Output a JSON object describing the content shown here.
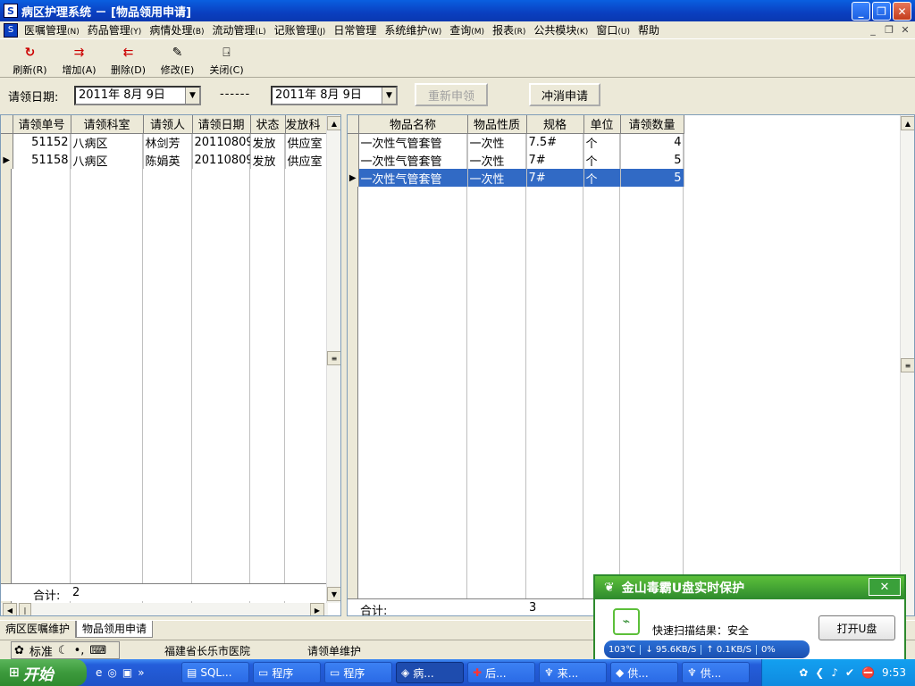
{
  "window": {
    "title": "病区护理系统 － [物品领用申请]"
  },
  "menu": [
    {
      "label": "医嘱管理",
      "hotkey": "(N)"
    },
    {
      "label": "药品管理",
      "hotkey": "(Y)"
    },
    {
      "label": "病情处理",
      "hotkey": "(B)"
    },
    {
      "label": "流动管理",
      "hotkey": "(L)"
    },
    {
      "label": "记账管理",
      "hotkey": "(J)"
    },
    {
      "label": "日常管理",
      "hotkey": ""
    },
    {
      "label": "系统维护",
      "hotkey": "(W)"
    },
    {
      "label": "查询",
      "hotkey": "(M)"
    },
    {
      "label": "报表",
      "hotkey": "(R)"
    },
    {
      "label": "公共模块",
      "hotkey": "(K)"
    },
    {
      "label": "窗口",
      "hotkey": "(U)"
    },
    {
      "label": "帮助",
      "hotkey": ""
    }
  ],
  "toolbar": {
    "refresh": "刷新(R)",
    "add": "增加(A)",
    "delete": "删除(D)",
    "edit": "修改(E)",
    "close": "关闭(C)"
  },
  "filter": {
    "label": "请领日期:",
    "date_from": "2011年 8月 9日",
    "separator": "------",
    "date_to": "2011年 8月 9日",
    "reapply_button": "重新申领",
    "cancel_button": "冲消申请"
  },
  "left_grid": {
    "columns": [
      "请领单号",
      "请领科室",
      "请领人",
      "请领日期",
      "状态",
      "发放科"
    ],
    "rows": [
      {
        "id": "51152",
        "dept": "八病区",
        "person": "林剑芳",
        "date": "20110809",
        "status": "发放",
        "supply": "供应室"
      },
      {
        "id": "51158",
        "dept": "八病区",
        "person": "陈娟英",
        "date": "20110809",
        "status": "发放",
        "supply": "供应室"
      }
    ],
    "summary_label": "合计:",
    "summary_value": "2"
  },
  "right_grid": {
    "columns": [
      "物品名称",
      "物品性质",
      "规格",
      "单位",
      "请领数量"
    ],
    "rows": [
      {
        "name": "一次性气管套管",
        "nature": "一次性",
        "spec": "7.5#",
        "unit": "个",
        "qty": "4"
      },
      {
        "name": "一次性气管套管",
        "nature": "一次性",
        "spec": "7#",
        "unit": "个",
        "qty": "5"
      },
      {
        "name": "一次性气管套管",
        "nature": "一次性",
        "spec": "7#",
        "unit": "个",
        "qty": "5"
      }
    ],
    "summary_label": "合计:",
    "summary_value": "3"
  },
  "tabs": [
    "病区医嘱维护",
    "物品领用申请"
  ],
  "status": {
    "ime_mode": "标准",
    "hospital": "福建省长乐市医院",
    "module": "请领单维护"
  },
  "popup": {
    "title": "金山毒霸U盘实时保护",
    "scan_result": "快速扫描结果：安全",
    "open_button": "打开U盘",
    "temp": "103℃",
    "down": "95.6KB/S",
    "up": "0.1KB/S",
    "load": "0%"
  },
  "taskbar": {
    "start": "开始",
    "tasks": [
      "SQL...",
      "程序",
      "程序",
      "病...",
      "后...",
      "来...",
      "供...",
      "供..."
    ],
    "clock": "9:53"
  },
  "colors": {
    "selection": "#316ac5",
    "title_blue": "#0a3fc0",
    "popup_green": "#2d8a2d"
  }
}
